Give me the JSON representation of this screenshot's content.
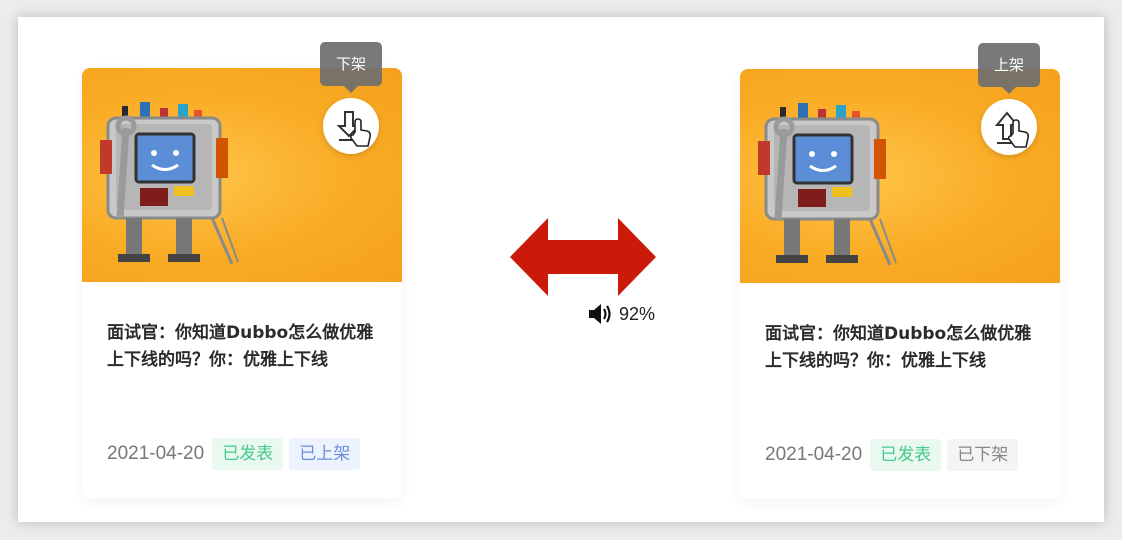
{
  "cards": [
    {
      "tooltip": "下架",
      "action_icon": "download-arrow-icon",
      "title": "面试官：你知道Dubbo怎么做优雅上下线的吗？你：优雅上下线",
      "date": "2021-04-20",
      "tags": [
        "已发表",
        "已上架"
      ]
    },
    {
      "tooltip": "上架",
      "action_icon": "upload-arrow-icon",
      "title": "面试官：你知道Dubbo怎么做优雅上下线的吗？你：优雅上下线",
      "date": "2021-04-20",
      "tags": [
        "已发表",
        "已下架"
      ]
    }
  ],
  "overlay": {
    "volume_icon": "speaker-icon",
    "volume_text": "92%",
    "arrow_icon": "double-arrow-icon",
    "arrow_color": "#cc1a0a"
  },
  "colors": {
    "cover_orange": "#f9ab24",
    "tag_green": "#48c98a",
    "tag_blue": "#6a8fd8",
    "tag_gray": "#888888"
  }
}
